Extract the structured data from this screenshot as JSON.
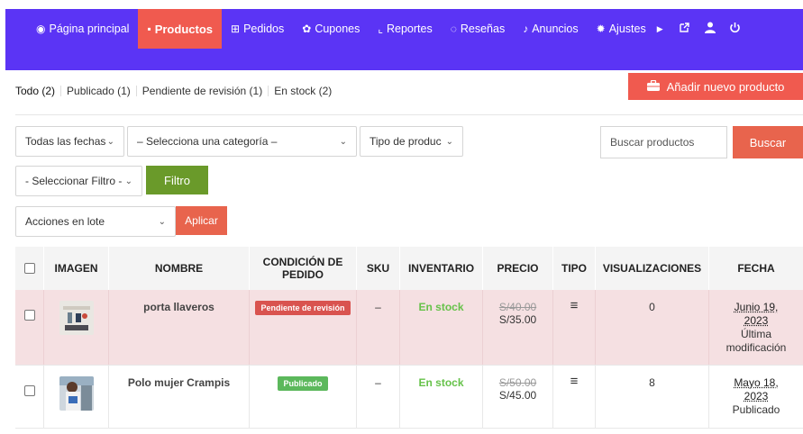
{
  "nav": {
    "items": [
      {
        "icon": "tachometer-icon",
        "glyph": "◉",
        "label": "Página principal"
      },
      {
        "icon": "briefcase-icon",
        "glyph": "▪",
        "label": "Productos",
        "active": true
      },
      {
        "icon": "cart-icon",
        "glyph": "⊞",
        "label": "Pedidos"
      },
      {
        "icon": "gift-icon",
        "glyph": "✿",
        "label": "Cupones"
      },
      {
        "icon": "line-chart-icon",
        "glyph": "⌞",
        "label": "Reportes"
      },
      {
        "icon": "comments-icon",
        "glyph": "◌",
        "label": "Reseñas"
      },
      {
        "icon": "bell-icon",
        "glyph": "♪",
        "label": "Anuncios"
      },
      {
        "icon": "cog-icon",
        "glyph": "✹",
        "label": "Ajustes"
      }
    ]
  },
  "status_filters": [
    {
      "label": "Todo",
      "count": "(2)"
    },
    {
      "label": "Publicado",
      "count": "(1)"
    },
    {
      "label": "Pendiente de revisión",
      "count": "(1)"
    },
    {
      "label": "En stock",
      "count": "(2)"
    }
  ],
  "add_button": "Añadir nuevo producto",
  "filters": {
    "dates": "Todas las fechas",
    "category": "– Selecciona una categoría –",
    "type": "Tipo de produc",
    "extra": "- Seleccionar Filtro -",
    "filter_button": "Filtro",
    "bulk": "Acciones en lote",
    "apply_button": "Aplicar",
    "search_placeholder": "Buscar productos",
    "search_button": "Buscar"
  },
  "table": {
    "headers": {
      "image": "IMAGEN",
      "name": "NOMBRE",
      "condition": "CONDICIÓN DE PEDIDO",
      "sku": "SKU",
      "inventory": "INVENTARIO",
      "price": "PRECIO",
      "type": "TIPO",
      "views": "VISUALIZACIONES",
      "date": "FECHA"
    },
    "rows": [
      {
        "name": "porta llaveros",
        "status": "Pendiente de revisión",
        "status_color": "#d9534f",
        "sku": "–",
        "stock": "En stock",
        "old_price": "S/40.00",
        "price": "S/35.00",
        "type_icon": "≡",
        "views": "0",
        "date": "Junio 19, 2023",
        "date_note": "Última modificación"
      },
      {
        "name": "Polo mujer Crampis",
        "status": "Publicado",
        "status_color": "#5cb85c",
        "sku": "–",
        "stock": "En stock",
        "old_price": "S/50.00",
        "price": "S/45.00",
        "type_icon": "≡",
        "views": "8",
        "date": "Mayo 18, 2023",
        "date_note": "Publicado"
      }
    ]
  }
}
